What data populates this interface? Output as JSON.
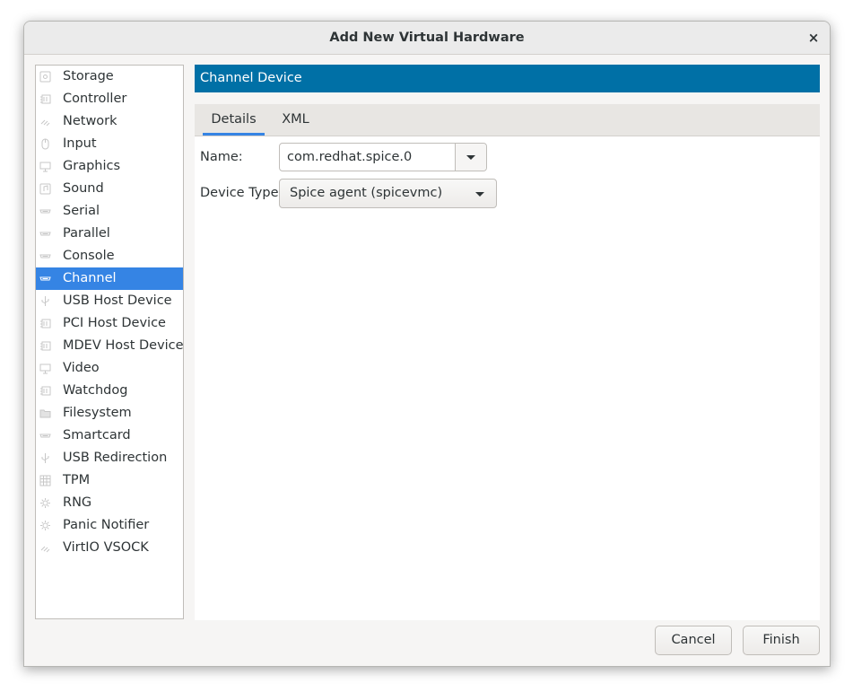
{
  "window": {
    "title": "Add New Virtual Hardware",
    "close_glyph": "×"
  },
  "hardware_list": {
    "selected": "Channel",
    "items": [
      {
        "label": "Storage",
        "icon": "disk-icon"
      },
      {
        "label": "Controller",
        "icon": "chip-icon"
      },
      {
        "label": "Network",
        "icon": "network-icon"
      },
      {
        "label": "Input",
        "icon": "mouse-icon"
      },
      {
        "label": "Graphics",
        "icon": "monitor-icon"
      },
      {
        "label": "Sound",
        "icon": "sound-icon"
      },
      {
        "label": "Serial",
        "icon": "serial-port-icon"
      },
      {
        "label": "Parallel",
        "icon": "serial-port-icon"
      },
      {
        "label": "Console",
        "icon": "serial-port-icon"
      },
      {
        "label": "Channel",
        "icon": "serial-port-icon"
      },
      {
        "label": "USB Host Device",
        "icon": "usb-icon"
      },
      {
        "label": "PCI Host Device",
        "icon": "chip-icon"
      },
      {
        "label": "MDEV Host Device",
        "icon": "chip-icon"
      },
      {
        "label": "Video",
        "icon": "monitor-icon"
      },
      {
        "label": "Watchdog",
        "icon": "chip-icon"
      },
      {
        "label": "Filesystem",
        "icon": "folder-icon"
      },
      {
        "label": "Smartcard",
        "icon": "serial-port-icon"
      },
      {
        "label": "USB Redirection",
        "icon": "usb-icon"
      },
      {
        "label": "TPM",
        "icon": "tpm-icon"
      },
      {
        "label": "RNG",
        "icon": "gear-icon"
      },
      {
        "label": "Panic Notifier",
        "icon": "gear-icon"
      },
      {
        "label": "VirtIO VSOCK",
        "icon": "network-icon"
      }
    ]
  },
  "content": {
    "header": "Channel Device",
    "tabs": [
      {
        "label": "Details",
        "active": true
      },
      {
        "label": "XML",
        "active": false
      }
    ],
    "name_label": "Name:",
    "name_value": "com.redhat.spice.0",
    "device_type_label": "Device Type:",
    "device_type_value": "Spice agent (spicevmc)"
  },
  "buttons": {
    "cancel": "Cancel",
    "finish": "Finish"
  },
  "colors": {
    "header": "#0070a6",
    "selection": "#3584e4",
    "tab_indicator": "#3584e4"
  }
}
